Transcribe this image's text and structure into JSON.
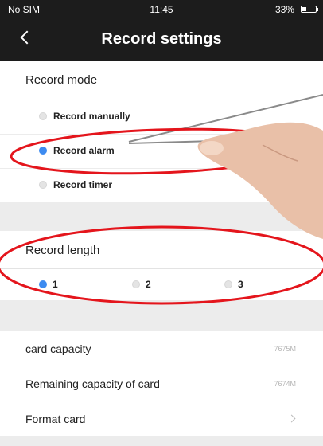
{
  "status_bar": {
    "carrier": "No SIM",
    "time": "11:45",
    "battery": "33%",
    "battery_level": 0.33
  },
  "nav": {
    "title": "Record settings",
    "back_icon": "chevron-left-icon"
  },
  "record_mode": {
    "title": "Record mode",
    "options": [
      {
        "label": "Record manually",
        "selected": false
      },
      {
        "label": "Record alarm",
        "selected": true
      },
      {
        "label": "Record timer",
        "selected": false
      }
    ]
  },
  "record_length": {
    "title": "Record length",
    "options": [
      {
        "label": "1",
        "selected": true
      },
      {
        "label": "2",
        "selected": false
      },
      {
        "label": "3",
        "selected": false
      }
    ]
  },
  "card": {
    "capacity_label": "card capacity",
    "capacity_value": "7675M",
    "remaining_label": "Remaining capacity of card",
    "remaining_value": "7674M",
    "format_label": "Format card"
  },
  "colors": {
    "radio_selected": "#3d8bf0",
    "annotation_red": "#e4151c",
    "header_bg": "#1c1c1c"
  }
}
